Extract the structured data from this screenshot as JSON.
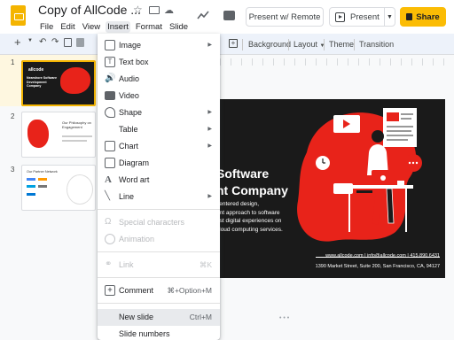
{
  "header": {
    "title": "Copy of AllCode ...",
    "menus": [
      "File",
      "Edit",
      "View",
      "Insert",
      "Format",
      "Slide"
    ],
    "present_remote_label": "Present w/ Remote",
    "present_label": "Present",
    "share_label": "Share"
  },
  "toolbar": {
    "zoom_label": "+",
    "background_label": "Background",
    "layout_label": "Layout",
    "theme_label": "Theme",
    "transition_label": "Transition"
  },
  "filmstrip": {
    "slide_numbers": [
      "1",
      "2",
      "3"
    ],
    "thumb1_brand": "allcode",
    "thumb1_title": "Nearshore Software Development Company",
    "thumb2_title": "Our Philosophy on Engagement",
    "thumb3_title": "Our Partner Network"
  },
  "insert_menu": {
    "items": [
      {
        "label": "Image",
        "icon": "image-icon",
        "submenu": true,
        "disabled": false,
        "shortcut": ""
      },
      {
        "label": "Text box",
        "icon": "text-box-icon",
        "submenu": false,
        "disabled": false,
        "shortcut": ""
      },
      {
        "label": "Audio",
        "icon": "audio-icon",
        "submenu": false,
        "disabled": false,
        "shortcut": ""
      },
      {
        "label": "Video",
        "icon": "video-icon",
        "submenu": false,
        "disabled": false,
        "shortcut": ""
      },
      {
        "label": "Shape",
        "icon": "shape-icon",
        "submenu": true,
        "disabled": false,
        "shortcut": ""
      },
      {
        "label": "Table",
        "icon": "",
        "submenu": true,
        "disabled": false,
        "shortcut": ""
      },
      {
        "label": "Chart",
        "icon": "chart-icon",
        "submenu": true,
        "disabled": false,
        "shortcut": ""
      },
      {
        "label": "Diagram",
        "icon": "diagram-icon",
        "submenu": false,
        "disabled": false,
        "shortcut": ""
      },
      {
        "label": "Word art",
        "icon": "word-art-icon",
        "submenu": false,
        "disabled": false,
        "shortcut": ""
      },
      {
        "label": "Line",
        "icon": "line-icon",
        "submenu": true,
        "disabled": false,
        "shortcut": ""
      },
      {
        "label": "Special characters",
        "icon": "special-characters-icon",
        "submenu": false,
        "disabled": true,
        "shortcut": ""
      },
      {
        "label": "Animation",
        "icon": "animation-icon",
        "submenu": false,
        "disabled": true,
        "shortcut": ""
      },
      {
        "label": "Link",
        "icon": "link-icon",
        "submenu": false,
        "disabled": true,
        "shortcut": "⌘K"
      },
      {
        "label": "Comment",
        "icon": "comment-add-icon",
        "submenu": false,
        "disabled": false,
        "shortcut": "⌘+Option+M"
      },
      {
        "label": "New slide",
        "icon": "",
        "submenu": false,
        "disabled": false,
        "shortcut": "Ctrl+M"
      },
      {
        "label": "Slide numbers",
        "icon": "",
        "submenu": false,
        "disabled": false,
        "shortcut": ""
      }
    ]
  },
  "slide": {
    "title_line1": "Software",
    "title_line2": "nt Company",
    "body_line1": "centered design,",
    "body_line2": "ent approach to software",
    "body_line3": "ust digital experiences on",
    "body_line4": "cloud computing services.",
    "contact_line1": "www.allcode.com | info@allcode.com | 415.890.6431",
    "contact_line2": "1390 Market Street, Suite 200, San Francisco, CA, 94127"
  },
  "colors": {
    "accent_red": "#e8231a",
    "share_yellow": "#fbbc04",
    "slide_bg": "#1a1a1a"
  }
}
